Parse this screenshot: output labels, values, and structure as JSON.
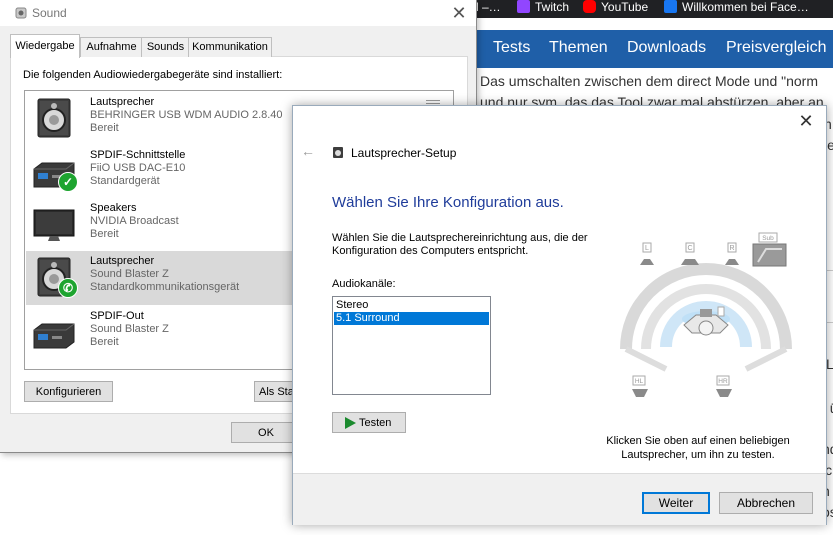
{
  "browser": {
    "bookmarks": [
      {
        "label": "d –…",
        "icon": "bookmark-icon"
      },
      {
        "label": "Twitch",
        "icon": "twitch-icon"
      },
      {
        "label": "YouTube",
        "icon": "youtube-icon"
      },
      {
        "label": "Willkommen bei Face…",
        "icon": "facebook-icon"
      }
    ],
    "nav": [
      "Tests",
      "Themen",
      "Downloads",
      "Preisvergleich"
    ],
    "article_lines": [
      "Das umschalten zwischen dem direct Mode und \"norm",
      "und nur sym. das das Tool zwar mal abstürzen, aber an",
      "h",
      "ie",
      "L",
      "t ü",
      "nd",
      "ic",
      "n (",
      "os"
    ],
    "colors": {
      "nav_bg": "#1f5fa8",
      "tabbar_bg": "#202124",
      "twitch": "#9146ff",
      "youtube": "#ff0000",
      "facebook": "#1877f2"
    }
  },
  "sound": {
    "title": "Sound",
    "close_icon": "close-icon",
    "tabs": [
      "Wiedergabe",
      "Aufnahme",
      "Sounds",
      "Kommunikation"
    ],
    "active_tab": "Wiedergabe",
    "caption": "Die folgenden Audiowiedergabegeräte sind installiert:",
    "devices": [
      {
        "name": "Lautsprecher",
        "detail": "BEHRINGER USB WDM AUDIO 2.8.40",
        "status": "Bereit",
        "icon": "speaker-icon",
        "badge": ""
      },
      {
        "name": "SPDIF-Schnittstelle",
        "detail": "FiiO USB DAC-E10",
        "status": "Standardgerät",
        "icon": "spdif-device-icon",
        "badge": "default-check-icon"
      },
      {
        "name": "Speakers",
        "detail": "NVIDIA Broadcast",
        "status": "Bereit",
        "icon": "monitor-icon",
        "badge": ""
      },
      {
        "name": "Lautsprecher",
        "detail": "Sound Blaster Z",
        "status": "Standardkommunikationsgerät",
        "icon": "speaker-icon",
        "badge": "phone-icon",
        "selected": true
      },
      {
        "name": "SPDIF-Out",
        "detail": "Sound Blaster Z",
        "status": "Bereit",
        "icon": "spdif-device-icon",
        "badge": ""
      }
    ],
    "buttons": {
      "configure": "Konfigurieren",
      "set_default": "Als Sta",
      "ok": "OK"
    }
  },
  "setup": {
    "title": "Lautsprecher-Setup",
    "heading": "Wählen Sie Ihre Konfiguration aus.",
    "instruction": "Wählen Sie die Lautsprechereinrichtung aus, die der Konfiguration des Computers entspricht.",
    "channels_label": "Audiokanäle:",
    "channel_options": [
      "Stereo",
      "5.1 Surround"
    ],
    "selected_channel": "5.1 Surround",
    "test_button": "Testen",
    "speaker_labels": {
      "left": "L",
      "center": "C",
      "right": "R",
      "sub": "Sub",
      "rear_left": "HL",
      "rear_right": "HR"
    },
    "hint": "Klicken Sie oben auf einen beliebigen Lautsprecher, um ihn zu testen.",
    "next_button": "Weiter",
    "cancel_button": "Abbrechen",
    "colors": {
      "heading": "#1f3c9a",
      "selection": "#0078d7"
    }
  }
}
